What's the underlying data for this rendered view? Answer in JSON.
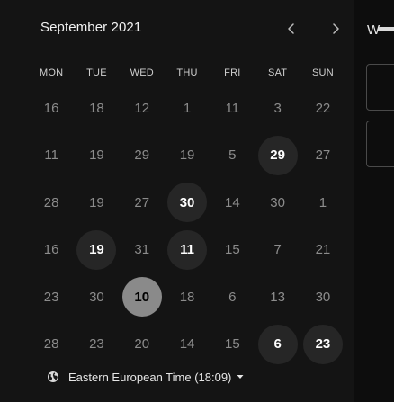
{
  "calendar": {
    "month_label": "September 2021",
    "weekdays": [
      "MON",
      "TUE",
      "WED",
      "THU",
      "FRI",
      "SAT",
      "SUN"
    ],
    "weeks": [
      [
        {
          "label": "16",
          "state": "muted"
        },
        {
          "label": "18",
          "state": "muted"
        },
        {
          "label": "12",
          "state": "muted"
        },
        {
          "label": "1",
          "state": "muted"
        },
        {
          "label": "11",
          "state": "muted"
        },
        {
          "label": "3",
          "state": "muted"
        },
        {
          "label": "22",
          "state": "muted"
        }
      ],
      [
        {
          "label": "11",
          "state": "muted"
        },
        {
          "label": "19",
          "state": "muted"
        },
        {
          "label": "29",
          "state": "muted"
        },
        {
          "label": "19",
          "state": "muted"
        },
        {
          "label": "5",
          "state": "muted"
        },
        {
          "label": "29",
          "state": "available"
        },
        {
          "label": "27",
          "state": "muted"
        }
      ],
      [
        {
          "label": "28",
          "state": "muted"
        },
        {
          "label": "19",
          "state": "muted"
        },
        {
          "label": "27",
          "state": "muted"
        },
        {
          "label": "30",
          "state": "available"
        },
        {
          "label": "14",
          "state": "muted"
        },
        {
          "label": "30",
          "state": "muted"
        },
        {
          "label": "1",
          "state": "muted"
        }
      ],
      [
        {
          "label": "16",
          "state": "muted"
        },
        {
          "label": "19",
          "state": "available"
        },
        {
          "label": "31",
          "state": "muted"
        },
        {
          "label": "11",
          "state": "available"
        },
        {
          "label": "15",
          "state": "muted"
        },
        {
          "label": "7",
          "state": "muted"
        },
        {
          "label": "21",
          "state": "muted"
        }
      ],
      [
        {
          "label": "23",
          "state": "muted"
        },
        {
          "label": "30",
          "state": "muted"
        },
        {
          "label": "10",
          "state": "selected"
        },
        {
          "label": "18",
          "state": "muted"
        },
        {
          "label": "6",
          "state": "muted"
        },
        {
          "label": "13",
          "state": "muted"
        },
        {
          "label": "30",
          "state": "muted"
        }
      ],
      [
        {
          "label": "28",
          "state": "muted"
        },
        {
          "label": "23",
          "state": "muted"
        },
        {
          "label": "20",
          "state": "muted"
        },
        {
          "label": "14",
          "state": "muted"
        },
        {
          "label": "15",
          "state": "muted"
        },
        {
          "label": "6",
          "state": "available"
        },
        {
          "label": "23",
          "state": "available"
        }
      ]
    ]
  },
  "timezone": {
    "label": "Eastern European Time (18:09)",
    "icon": "globe-icon"
  },
  "side": {
    "heading_letter": "W"
  },
  "icons": {
    "prev": "chevron-left-icon",
    "next": "chevron-right-icon",
    "caret": "caret-down-icon"
  },
  "colors": {
    "background": "#141414",
    "available_day": "#262626",
    "selected_day": "#8a8a8a",
    "muted_text": "#8c8c8c"
  }
}
